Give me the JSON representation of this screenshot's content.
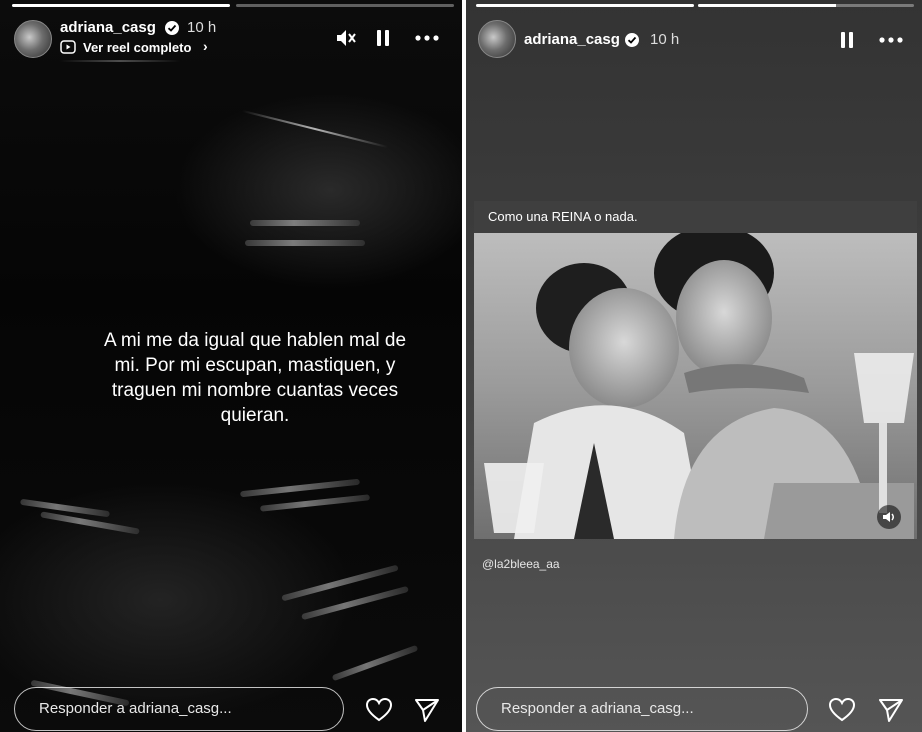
{
  "left_story": {
    "progress": [
      1.0,
      0.0
    ],
    "username": "adriana_casg",
    "time": "10 h",
    "reel_link": "Ver reel completo",
    "text": "A mi me da igual que hablen mal de mi. Por mi escupan, mastiquen, y traguen mi nombre cuantas veces quieran.",
    "reply_placeholder": "Responder a adriana_casg..."
  },
  "right_story": {
    "progress": [
      1.0,
      0.64
    ],
    "username": "adriana_casg",
    "time": "10 h",
    "card_title": "Como una REINA o nada.",
    "credit": "@la2bleea_aa",
    "reply_placeholder": "Responder a adriana_casg..."
  },
  "icons": {
    "verified": "verified-badge-icon",
    "mute": "speaker-muted-icon",
    "pause": "pause-icon",
    "more": "more-dots-icon",
    "like": "heart-icon",
    "send": "paper-plane-icon",
    "reel": "reel-icon",
    "volume": "volume-icon"
  },
  "colors": {
    "text": "#ffffff",
    "muted": "#dddddd",
    "left_bg": "#080808",
    "right_bg": "#3b3b3b"
  }
}
